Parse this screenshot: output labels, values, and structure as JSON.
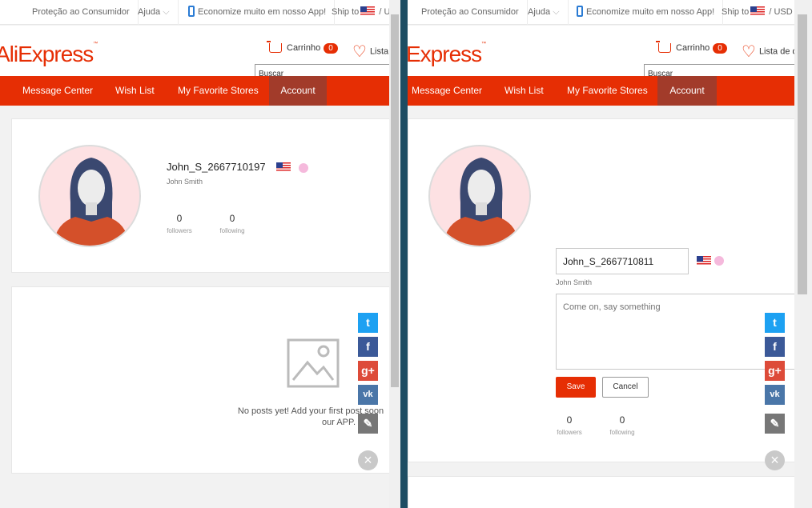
{
  "topbar": {
    "consumer_protection": "Proteção ao Consumidor",
    "help": "Ajuda",
    "chevron": "⌵",
    "app_promo": "Economize muito em nosso App!",
    "ship_to": "Ship to",
    "separator": "/",
    "currency_left": "U",
    "currency_right": "USD"
  },
  "header": {
    "logo_left": "AliExpress",
    "logo_right": "Express",
    "logo_tm": "™",
    "cart_label": "Carrinho",
    "cart_count": "0",
    "wishlist_left": "Lista",
    "wishlist_right": "Lista de d",
    "search_placeholder": "Buscar"
  },
  "nav": {
    "items": [
      "Message Center",
      "Wish List",
      "My Favorite Stores",
      "Account"
    ],
    "active": "Account"
  },
  "left_profile": {
    "username": "John_S_2667710197",
    "real_name": "John Smith",
    "followers_count": "0",
    "followers_label": "followers",
    "following_count": "0",
    "following_label": "following"
  },
  "left_posts": {
    "empty_message_line1": "No posts yet! Add your first post soon",
    "empty_message_line2": "our APP."
  },
  "right_profile": {
    "username_value": "John_S_2667710811",
    "real_name": "John Smith",
    "bio_placeholder": "Come on, say something",
    "save_label": "Save",
    "cancel_label": "Cancel",
    "followers_count": "0",
    "followers_label": "followers",
    "following_count": "0",
    "following_label": "following"
  },
  "social": {
    "twitter_glyph": "t",
    "facebook_glyph": "f",
    "google_glyph": "g+",
    "vk_glyph": "vk",
    "edit_glyph": "✎",
    "close_glyph": "×"
  },
  "colors": {
    "brand_red": "#e62e04",
    "nav_active": "#a23b2a",
    "twitter": "#1da1f2",
    "facebook": "#3b5998",
    "google": "#dd4b39",
    "vk": "#4a76a8",
    "edit": "#777777",
    "window_gap": "#1d4d63"
  },
  "icons": [
    "phone-icon",
    "us-flag-icon",
    "cart-icon",
    "heart-icon",
    "avatar-icon",
    "image-placeholder-icon",
    "twitter-icon",
    "facebook-icon",
    "google-plus-icon",
    "vk-icon",
    "edit-icon",
    "close-icon"
  ]
}
